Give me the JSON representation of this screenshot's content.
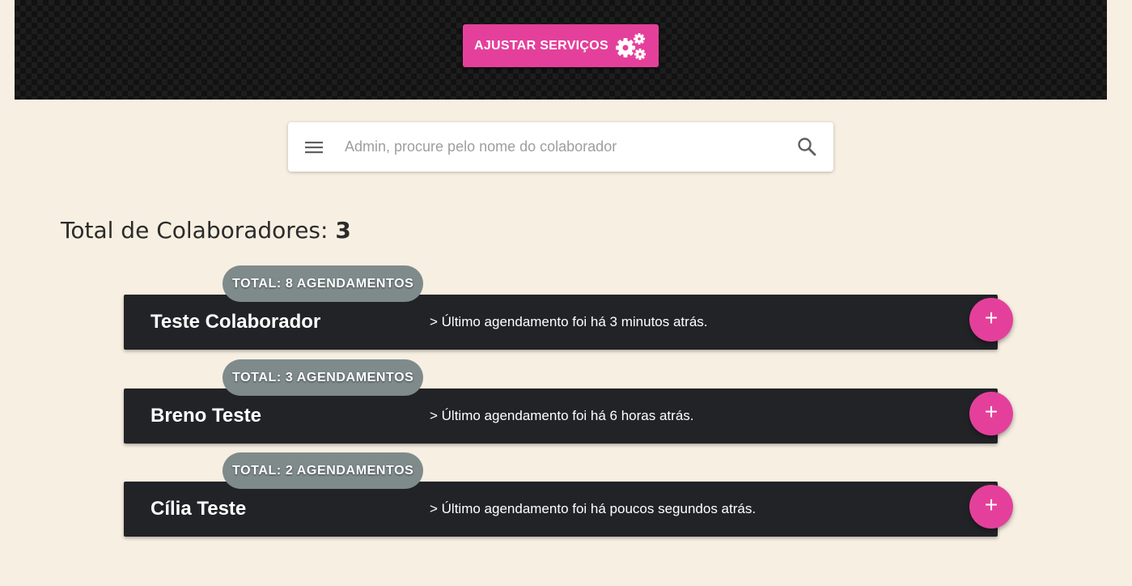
{
  "header": {
    "services_button": {
      "label": "AJUSTAR SERVIÇOS",
      "icon": "gears-icon"
    }
  },
  "search": {
    "placeholder": "Admin, procure pelo nome do colaborador",
    "value": "",
    "menu_icon": "menu-icon",
    "search_icon": "search-icon"
  },
  "summary": {
    "label": "Total de Colaboradores:",
    "count": "3"
  },
  "collaborators": [
    {
      "badge": "TOTAL: 8 AGENDAMENTOS",
      "name": "Teste Colaborador",
      "last": "> Último agendamento foi há 3 minutos atrás.",
      "add_label": "+"
    },
    {
      "badge": "TOTAL: 3 AGENDAMENTOS",
      "name": "Breno Teste",
      "last": "> Último agendamento foi há 6 horas atrás.",
      "add_label": "+"
    },
    {
      "badge": "TOTAL: 2 AGENDAMENTOS",
      "name": "Cília Teste",
      "last": "> Último agendamento foi há poucos segundos atrás.",
      "add_label": "+"
    }
  ],
  "colors": {
    "accent": "#e4409b",
    "background": "#f7efe2",
    "card": "#222327",
    "badge": "#7f8b8b"
  }
}
